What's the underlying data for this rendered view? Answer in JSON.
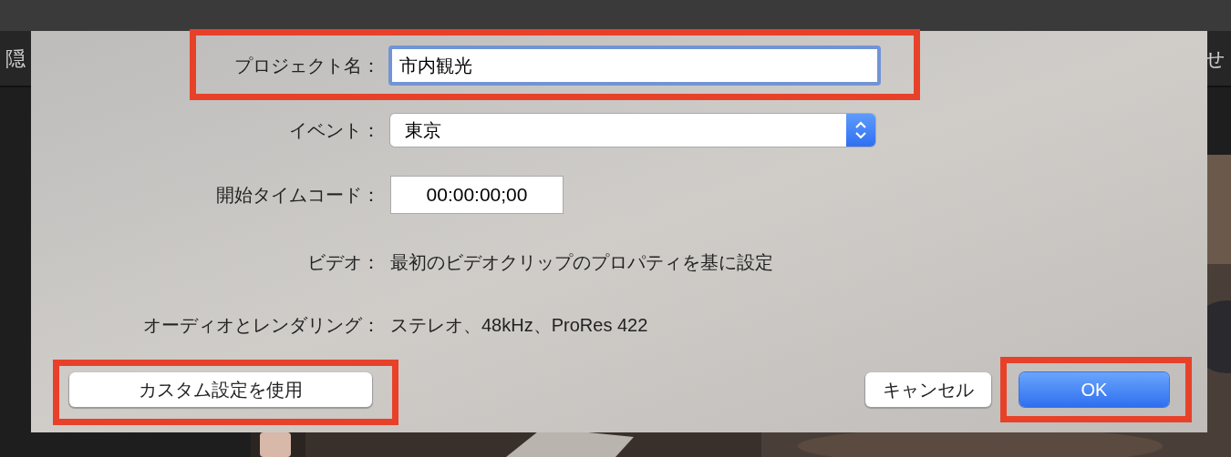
{
  "background": {
    "toolbar_texts": [
      "隠",
      "せ"
    ]
  },
  "dialog": {
    "rows": [
      {
        "kind": "text_field",
        "label": "プロジェクト名：",
        "value": "市内観光",
        "focused": true
      },
      {
        "kind": "popup",
        "label": "イベント：",
        "value": "東京"
      },
      {
        "kind": "timecode",
        "label": "開始タイムコード：",
        "value": "00:00:00;00"
      },
      {
        "kind": "info",
        "label": "ビデオ：",
        "value": "最初のビデオクリップのプロパティを基に設定"
      },
      {
        "kind": "info",
        "label": "オーディオとレンダリング：",
        "value": "ステレオ、48kHz、ProRes 422"
      }
    ],
    "buttons": [
      {
        "label": "カスタム設定を使用",
        "default": false
      },
      {
        "label": "キャンセル",
        "default": false
      },
      {
        "label": "OK",
        "default": true
      }
    ]
  }
}
